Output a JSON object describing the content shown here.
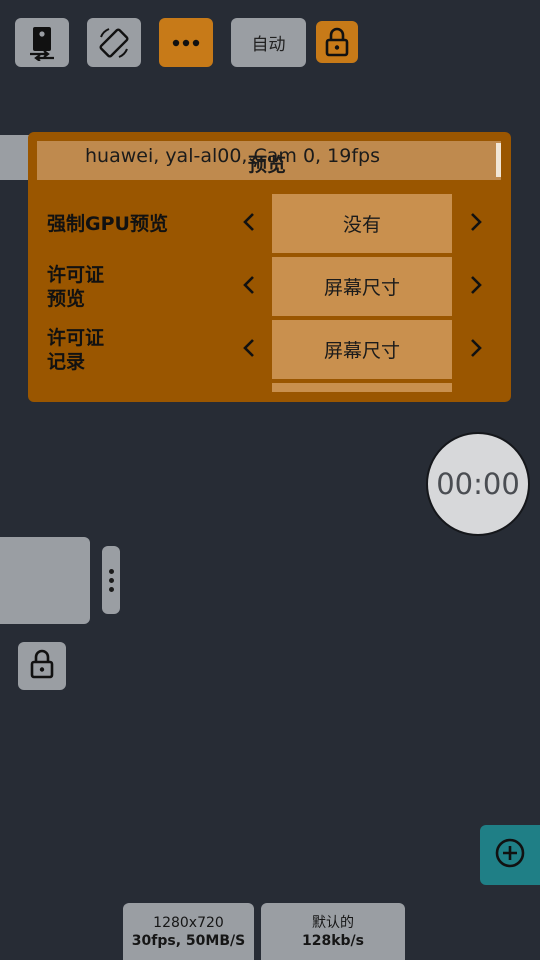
{
  "toolbar": {
    "auto_label": "自动",
    "icons": [
      "camera-switch-icon",
      "screen-rotation-icon",
      "more-horizontal-icon",
      "lock-icon"
    ]
  },
  "settings_panel": {
    "device_info": "huawei, yal-al00, Cam 0, 19fps",
    "title": "预览",
    "rows": [
      {
        "label": "强制GPU预览",
        "value": "没有"
      },
      {
        "label": "许可证\n预览",
        "value": "屏幕尺寸"
      },
      {
        "label": "许可证\n记录",
        "value": "屏幕尺寸"
      }
    ]
  },
  "timer": {
    "text": "00:00"
  },
  "bottom": {
    "video": {
      "line1": "1280x720",
      "line2": "30fps, 50MB/S"
    },
    "audio": {
      "line1": "默认的",
      "line2": "128kb/s"
    }
  },
  "colors": {
    "background": "#272c35",
    "panel": "#9a5600",
    "accent_orange": "#c77a18",
    "button_grey": "#9a9ea3",
    "fab_teal": "#1f7f86"
  }
}
